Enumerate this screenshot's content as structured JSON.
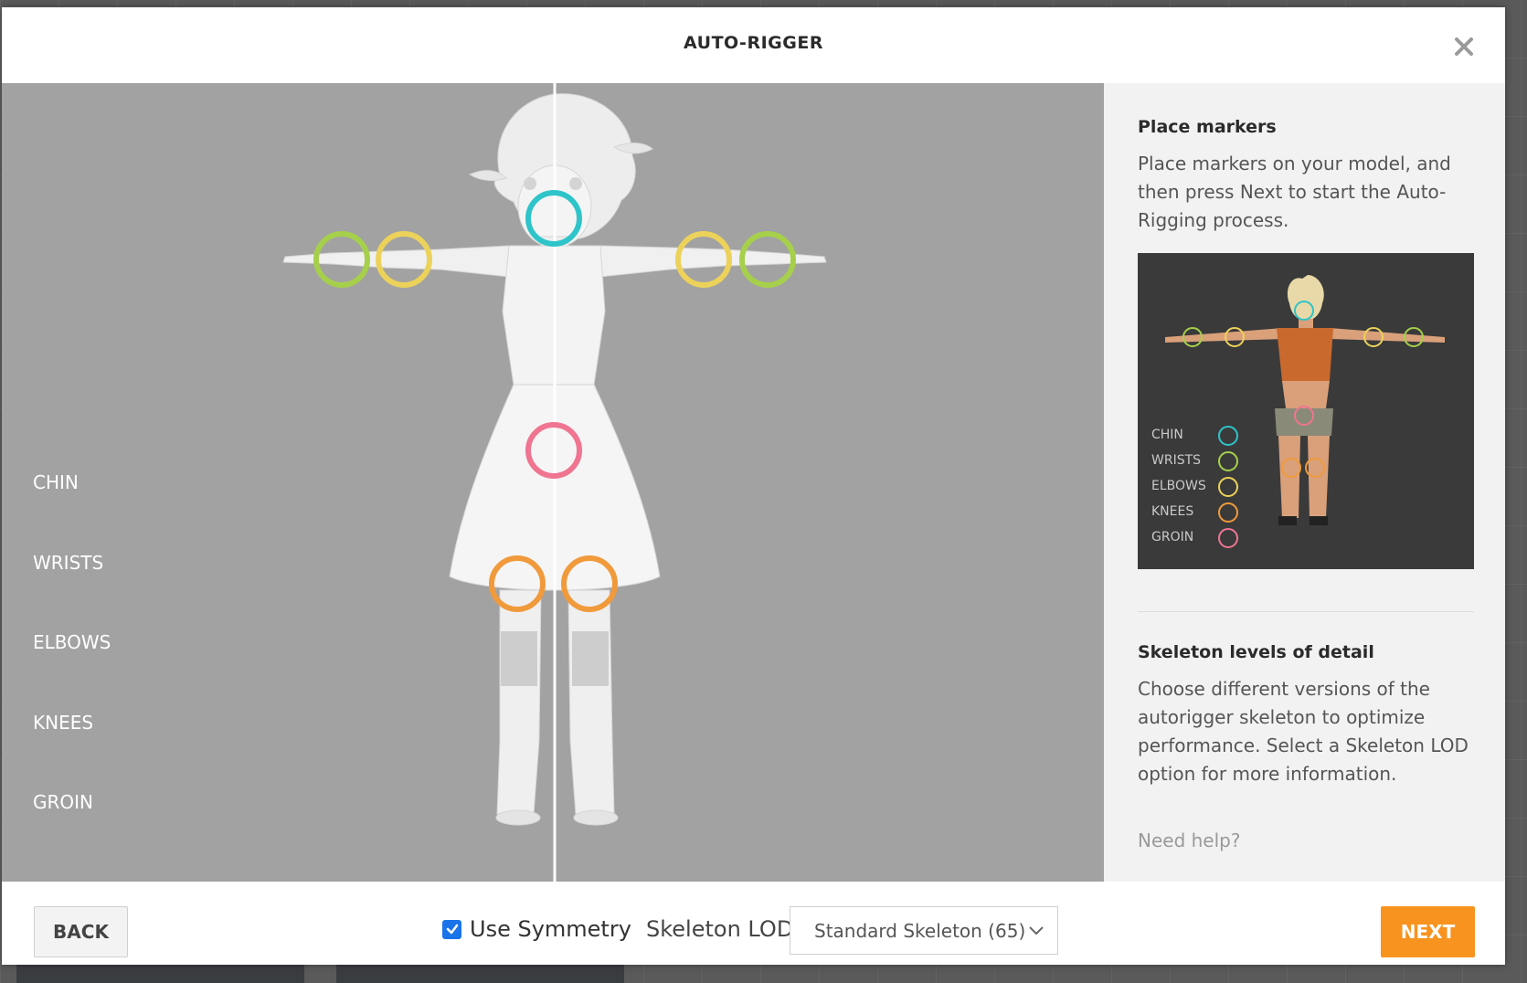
{
  "dialog": {
    "title": "AUTO-RIGGER",
    "close_icon": "close-icon"
  },
  "viewport": {
    "marker_labels": [
      "CHIN",
      "WRISTS",
      "ELBOWS",
      "KNEES",
      "GROIN"
    ],
    "marker_colors": {
      "chin": "#2ec4c9",
      "wrists": "#a6d04b",
      "elbows": "#ecd25a",
      "knees": "#f09a3c",
      "groin": "#ef7591"
    }
  },
  "side_panel": {
    "place_markers_heading": "Place markers",
    "place_markers_text": "Place markers on your model, and then press Next to start the Auto-Rigging process.",
    "reference_legend": [
      "CHIN",
      "WRISTS",
      "ELBOWS",
      "KNEES",
      "GROIN"
    ],
    "lod_heading": "Skeleton levels of detail",
    "lod_text": "Choose different versions of the autorigger skeleton to optimize performance. Select a Skeleton LOD option for more information.",
    "help_link": "Need help?"
  },
  "footer": {
    "back_label": "BACK",
    "symmetry_label": "Use Symmetry",
    "symmetry_checked": true,
    "lod_label": "Skeleton LOD",
    "lod_selected": "Standard Skeleton (65)",
    "next_label": "NEXT"
  },
  "colors": {
    "accent": "#f7931e",
    "viewport_bg": "#a2a2a2",
    "panel_bg": "#f2f2f2",
    "checkbox": "#1a73e8"
  }
}
